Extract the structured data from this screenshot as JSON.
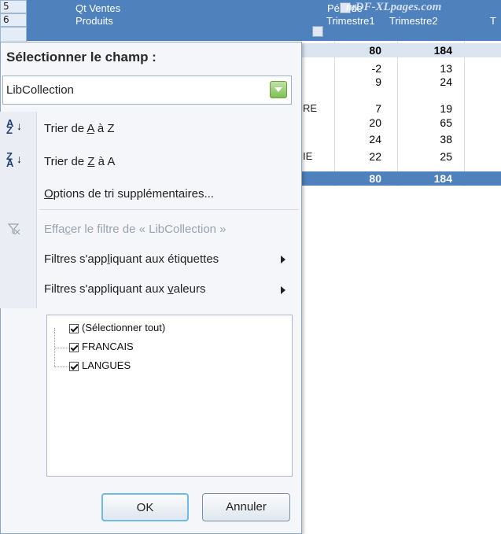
{
  "sheet": {
    "row_numbers": [
      "5",
      "6"
    ],
    "header_line1": "Qt Ventes",
    "header_line2": "Produits",
    "period_label": "Période",
    "watermark": "mDF-XLpages.com",
    "quarters": [
      "Trimestre1",
      "Trimestre2"
    ],
    "fragments": [
      "RE",
      "IE"
    ],
    "rows": [
      {
        "q1": "80",
        "q2": "184"
      },
      {
        "q1": "-2",
        "q2": "13"
      },
      {
        "q1": "9",
        "q2": "24"
      },
      {
        "q1": "7",
        "q2": "19"
      },
      {
        "q1": "20",
        "q2": "65"
      },
      {
        "q1": "24",
        "q2": "38"
      },
      {
        "q1": "22",
        "q2": "25"
      },
      {
        "q1": "80",
        "q2": "184"
      }
    ],
    "header_color": "#4f81bd"
  },
  "panel": {
    "title": "Sélectionner le champ :",
    "field_value": "LibCollection",
    "sort_az": {
      "pre": "Trier de ",
      "u": "A",
      "post": " à Z",
      "icon": "A→Z"
    },
    "sort_za": {
      "pre": "Trier de ",
      "u": "Z",
      "post": " à A",
      "icon": "Z→A"
    },
    "more_sort": {
      "u": "O",
      "post": "ptions de tri supplémentaires..."
    },
    "clear_filter": {
      "pre": "Effa",
      "u": "c",
      "post": "er le filtre de « LibCollection »"
    },
    "label_filters": {
      "pre": "Filtres s'app",
      "u": "l",
      "post": "iquant aux étiquettes"
    },
    "value_filters": {
      "pre": "Filtres s'appliquant aux ",
      "u": "v",
      "post": "aleurs"
    },
    "items": [
      {
        "label": "(Sélectionner tout)",
        "checked": true
      },
      {
        "label": "FRANCAIS",
        "checked": true
      },
      {
        "label": "LANGUES",
        "checked": true
      }
    ],
    "ok_label": "OK",
    "cancel_label": "Annuler"
  }
}
